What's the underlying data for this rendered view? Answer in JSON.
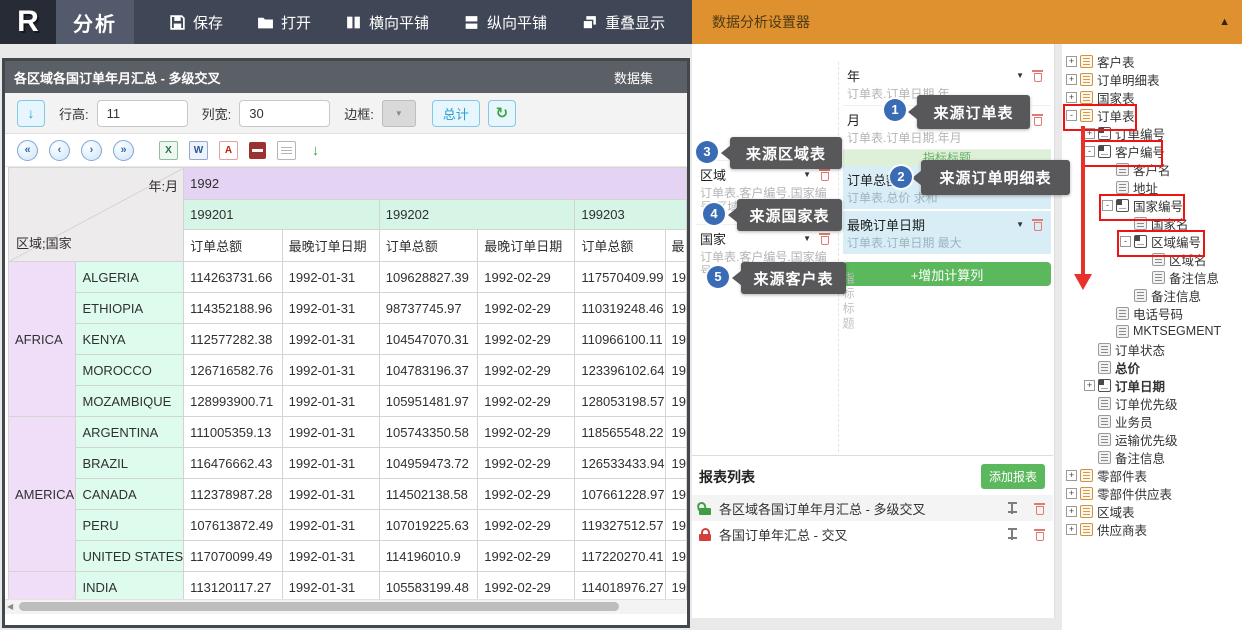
{
  "toolbar": {
    "logo_text": "R",
    "app_tab": "分析",
    "buttons": [
      {
        "icon": "save-icon",
        "label": "保存"
      },
      {
        "icon": "open-icon",
        "label": "打开"
      },
      {
        "icon": "tile-horizontal-icon",
        "label": "横向平铺"
      },
      {
        "icon": "tile-vertical-icon",
        "label": "纵向平铺"
      },
      {
        "icon": "overlap-icon",
        "label": "重叠显示"
      }
    ]
  },
  "settings_panel": {
    "title": "数据分析设置器",
    "collapse_icon": "▲"
  },
  "window": {
    "title": "各区域各国订单年月汇总 - 多级交叉",
    "dataset_label": "数据集",
    "controls": {
      "row_height_label": "行高:",
      "row_height_value": "11",
      "col_width_label": "列宽:",
      "col_width_value": "30",
      "border_label": "边框:",
      "total_button": "总计"
    }
  },
  "pager": {
    "first": "«",
    "prev": "‹",
    "next": "›",
    "last": "»"
  },
  "export_icons": [
    "excel-icon",
    "word-icon",
    "pdf-icon",
    "print-icon",
    "document-icon",
    "download-icon"
  ],
  "table": {
    "corner_col_label": "年:月",
    "corner_row_label": "区域;国家",
    "year_header": "1992",
    "month_headers": [
      "199201",
      "199202",
      "199203"
    ],
    "measure_headers": [
      "订单总额",
      "最晚订单日期"
    ],
    "clipped_measure_header": "最",
    "clipped_value": "19",
    "groups": [
      {
        "region": "AFRICA",
        "rows": [
          {
            "country": "ALGERIA",
            "cells": [
              "114263731.66",
              "1992-01-31",
              "109628827.39",
              "1992-02-29",
              "117570409.99"
            ]
          },
          {
            "country": "ETHIOPIA",
            "cells": [
              "114352188.96",
              "1992-01-31",
              "98737745.97",
              "1992-02-29",
              "110319248.46"
            ]
          },
          {
            "country": "KENYA",
            "cells": [
              "112577282.38",
              "1992-01-31",
              "104547070.31",
              "1992-02-29",
              "110966100.11"
            ]
          },
          {
            "country": "MOROCCO",
            "cells": [
              "126716582.76",
              "1992-01-31",
              "104783196.37",
              "1992-02-29",
              "123396102.64"
            ]
          },
          {
            "country": "MOZAMBIQUE",
            "cells": [
              "128993900.71",
              "1992-01-31",
              "105951481.97",
              "1992-02-29",
              "128053198.57"
            ]
          }
        ]
      },
      {
        "region": "AMERICA",
        "rows": [
          {
            "country": "ARGENTINA",
            "cells": [
              "111005359.13",
              "1992-01-31",
              "105743350.58",
              "1992-02-29",
              "118565548.22"
            ]
          },
          {
            "country": "BRAZIL",
            "cells": [
              "116476662.43",
              "1992-01-31",
              "104959473.72",
              "1992-02-29",
              "126533433.94"
            ]
          },
          {
            "country": "CANADA",
            "cells": [
              "112378987.28",
              "1992-01-31",
              "114502138.58",
              "1992-02-29",
              "107661228.97"
            ]
          },
          {
            "country": "PERU",
            "cells": [
              "107613872.49",
              "1992-01-31",
              "107019225.63",
              "1992-02-29",
              "119327512.57"
            ]
          },
          {
            "country": "UNITED STATES",
            "cells": [
              "117070099.49",
              "1992-01-31",
              "114196010.9",
              "1992-02-29",
              "117220270.41"
            ]
          }
        ]
      },
      {
        "region": "",
        "rows": [
          {
            "country": "INDIA",
            "cells": [
              "113120117.27",
              "1992-01-31",
              "105583199.48",
              "1992-02-29",
              "114018976.27"
            ]
          }
        ]
      }
    ]
  },
  "designer": {
    "column_fields": [
      {
        "name": "年",
        "source": "订单表.订单日期.年"
      },
      {
        "name": "月",
        "source": "订单表.订单日期.年月"
      }
    ],
    "row_fields": [
      {
        "name": "区域",
        "source": "订单表.客户编号.国家编号.区域编号"
      },
      {
        "name": "国家",
        "source": "订单表.客户编号.国家编号"
      }
    ],
    "metric_title_strip": "指标标题",
    "metric_title_vertical": "指标标题",
    "metrics": [
      {
        "name": "订单总额",
        "source": "订单表.总价 求和"
      },
      {
        "name": "最晚订单日期",
        "source": "订单表.订单日期 最大"
      }
    ],
    "add_calc_column_button": "+增加计算列"
  },
  "callouts": [
    {
      "number": "1",
      "text": "来源订单表"
    },
    {
      "number": "2",
      "text": "来源订单明细表"
    },
    {
      "number": "3",
      "text": "来源区域表"
    },
    {
      "number": "4",
      "text": "来源国家表"
    },
    {
      "number": "5",
      "text": "来源客户表"
    }
  ],
  "report_list": {
    "title": "报表列表",
    "add_button": "添加报表",
    "items": [
      {
        "name": "各区域各国订单年月汇总 - 多级交叉",
        "locked": false
      },
      {
        "name": "各国订单年汇总 - 交叉",
        "locked": true
      }
    ]
  },
  "field_tree": {
    "items": [
      {
        "label": "客户表",
        "level": 0,
        "expander": "plus",
        "icon": "table"
      },
      {
        "label": "订单明细表",
        "level": 0,
        "expander": "plus",
        "icon": "table"
      },
      {
        "label": "国家表",
        "level": 0,
        "expander": "plus",
        "icon": "table"
      },
      {
        "label": "订单表",
        "level": 0,
        "expander": "minus",
        "icon": "table",
        "highlighted": true
      },
      {
        "label": "订单编号",
        "level": 1,
        "expander": "plus",
        "icon": "link"
      },
      {
        "label": "客户编号",
        "level": 1,
        "expander": "minus",
        "icon": "link",
        "highlighted": true
      },
      {
        "label": "客户名",
        "level": 2,
        "icon": "field"
      },
      {
        "label": "地址",
        "level": 2,
        "icon": "field"
      },
      {
        "label": "国家编号",
        "level": 2,
        "expander": "minus",
        "icon": "link",
        "highlighted": true
      },
      {
        "label": "国家名",
        "level": 3,
        "icon": "field"
      },
      {
        "label": "区域编号",
        "level": 3,
        "expander": "minus",
        "icon": "link",
        "highlighted": true
      },
      {
        "label": "区域名",
        "level": 4,
        "icon": "field"
      },
      {
        "label": "备注信息",
        "level": 4,
        "icon": "field"
      },
      {
        "label": "备注信息",
        "level": 3,
        "icon": "field"
      },
      {
        "label": "电话号码",
        "level": 2,
        "icon": "field"
      },
      {
        "label": "MKTSEGMENT",
        "level": 2,
        "icon": "field"
      },
      {
        "label": "订单状态",
        "level": 1,
        "icon": "field"
      },
      {
        "label": "总价",
        "level": 1,
        "icon": "field",
        "bold": true
      },
      {
        "label": "订单日期",
        "level": 1,
        "expander": "plus",
        "icon": "link",
        "bold": true
      },
      {
        "label": "订单优先级",
        "level": 1,
        "icon": "field"
      },
      {
        "label": "业务员",
        "level": 1,
        "icon": "field"
      },
      {
        "label": "运输优先级",
        "level": 1,
        "icon": "field"
      },
      {
        "label": "备注信息",
        "level": 1,
        "icon": "field"
      },
      {
        "label": "零部件表",
        "level": 0,
        "expander": "plus",
        "icon": "table"
      },
      {
        "label": "零部件供应表",
        "level": 0,
        "expander": "plus",
        "icon": "table"
      },
      {
        "label": "区域表",
        "level": 0,
        "expander": "plus",
        "icon": "table"
      },
      {
        "label": "供应商表",
        "level": 0,
        "expander": "plus",
        "icon": "table"
      }
    ]
  }
}
